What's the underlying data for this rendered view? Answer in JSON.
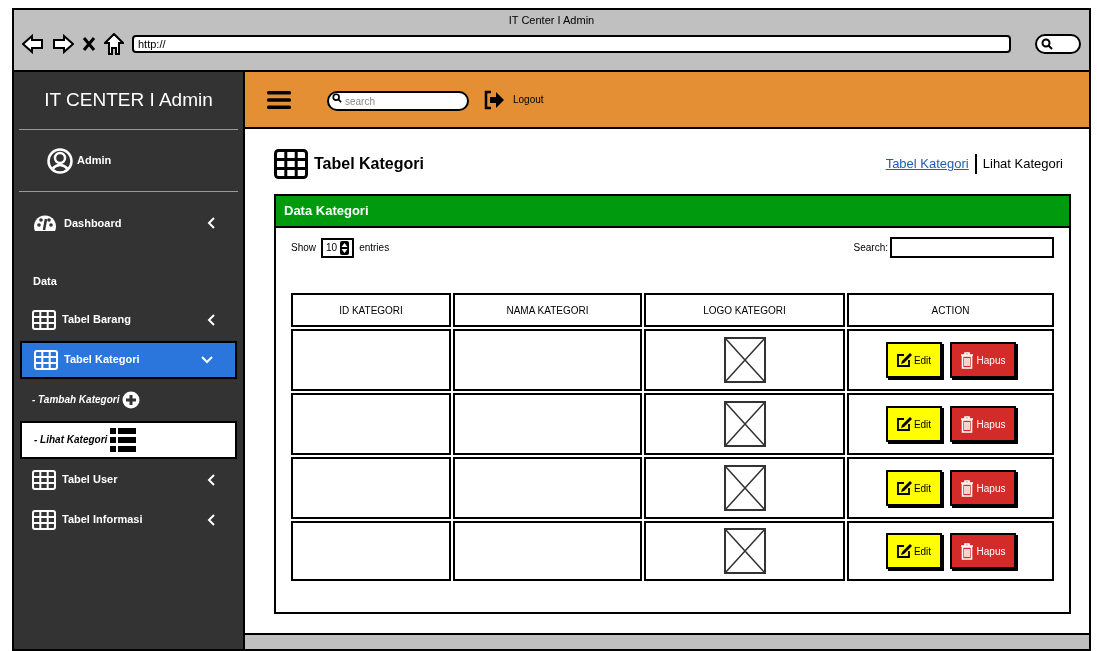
{
  "browser": {
    "title": "IT Center I Admin",
    "url": "http://"
  },
  "sidebar": {
    "brand": "IT CENTER I Admin",
    "user": "Admin",
    "items": [
      {
        "kind": "dashboard",
        "label": "Dashboard",
        "selected": false,
        "expanded": false
      },
      {
        "kind": "section",
        "label": "Data"
      },
      {
        "kind": "table",
        "label": "Tabel Barang",
        "selected": false,
        "expanded": false
      },
      {
        "kind": "table",
        "label": "Tabel Kategori",
        "selected": true,
        "expanded": true
      },
      {
        "kind": "add",
        "label": "- Tambah Kategori",
        "selected": false
      },
      {
        "kind": "view",
        "label": "- Lihat Kategori",
        "selected": true
      },
      {
        "kind": "table",
        "label": "Tabel User",
        "selected": false,
        "expanded": false
      },
      {
        "kind": "table",
        "label": "Tabel Informasi",
        "selected": false,
        "expanded": false
      }
    ]
  },
  "topbar": {
    "search_placeholder": "search",
    "logout": "Logout"
  },
  "page": {
    "title": "Tabel Kategori",
    "breadcrumb": [
      {
        "label": "Tabel Kategori",
        "link": true
      },
      {
        "label": "Lihat Kategori",
        "link": false
      }
    ]
  },
  "panel": {
    "title": "Data Kategori",
    "show_label": "Show",
    "page_size": "10",
    "entries_label": "entries",
    "search_label": "Search:"
  },
  "table": {
    "columns": [
      "ID KATEGORI",
      "NAMA KATEGORI",
      "LOGO KATEGORI",
      "ACTION"
    ],
    "rows": [
      {
        "edit": "Edit",
        "delete": "Hapus"
      },
      {
        "edit": "Edit",
        "delete": "Hapus"
      },
      {
        "edit": "Edit",
        "delete": "Hapus"
      },
      {
        "edit": "Edit",
        "delete": "Hapus"
      }
    ]
  }
}
